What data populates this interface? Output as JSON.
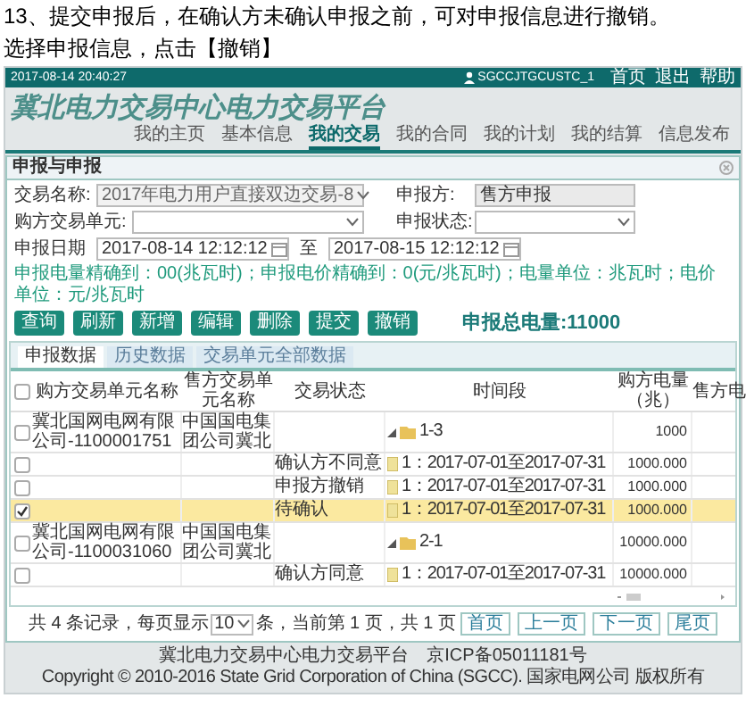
{
  "instructions": [
    "13、提交申报后，在确认方未确认申报之前，可对申报信息进行撤销。",
    "选择申报信息，点击【撤销】"
  ],
  "top_bar": {
    "datetime": "2017-08-14 20:40:27",
    "user": "SGCCJTGCUSTC_1",
    "links": [
      "首页",
      "退出",
      "帮助"
    ]
  },
  "site_title": "冀北电力交易中心电力交易平台",
  "nav": [
    {
      "label": "我的主页",
      "selected": false
    },
    {
      "label": "基本信息",
      "selected": false
    },
    {
      "label": "我的交易",
      "selected": true
    },
    {
      "label": "我的合同",
      "selected": false
    },
    {
      "label": "我的计划",
      "selected": false
    },
    {
      "label": "我的结算",
      "selected": false
    },
    {
      "label": "信息发布",
      "selected": false
    }
  ],
  "dialog": {
    "title": "申报与申报",
    "form": {
      "trade_label": "交易名称:",
      "trade_value": "2017年电力用户直接双边交易-8",
      "declarer_label": "申报方:",
      "declarer_value": "售方申报",
      "buyer_unit_label": "购方交易单元:",
      "status_label": "申报状态:",
      "date_label": "申报日期",
      "date_from": "2017-08-14 12:12:12",
      "date_sep": "至",
      "date_to": "2017-08-15 12:12:12"
    },
    "note": "申报电量精确到：00(兆瓦时)；申报电价精确到：0(元/兆瓦时)；电量单位：兆瓦时；电价单位：元/兆瓦时",
    "buttons": [
      "查询",
      "刷新",
      "新增",
      "编辑",
      "删除",
      "提交",
      "撤销"
    ],
    "total": "申报总电量:11000",
    "tabs": [
      {
        "label": "申报数据",
        "selected": true
      },
      {
        "label": "历史数据",
        "selected": false
      },
      {
        "label": "交易单元全部数据",
        "selected": false
      }
    ],
    "table": {
      "all_checked": false,
      "columns": [
        "购方交易单元名称",
        "售方交易单元名称",
        "交易状态",
        "时间段",
        "购方电量（兆）",
        "售方电"
      ],
      "rows": [
        {
          "kind": "group",
          "checked": false,
          "selected": false,
          "expanded": true,
          "buyer": "冀北国网电网有限公司-1100001751",
          "seller": "中国国电集团公司冀北",
          "status": "",
          "period": "1-3",
          "quantity": "1000"
        },
        {
          "kind": "item",
          "checked": false,
          "selected": false,
          "buyer": "",
          "seller": "",
          "status": "确认方不同意",
          "period": "1：2017-07-01至2017-07-31",
          "quantity": "1000.000"
        },
        {
          "kind": "item",
          "checked": false,
          "selected": false,
          "buyer": "",
          "seller": "",
          "status": "申报方撤销",
          "period": "1：2017-07-01至2017-07-31",
          "quantity": "1000.000"
        },
        {
          "kind": "item",
          "checked": true,
          "selected": true,
          "buyer": "",
          "seller": "",
          "status": "待确认",
          "period": "1：2017-07-01至2017-07-31",
          "quantity": "1000.000"
        },
        {
          "kind": "group",
          "checked": false,
          "selected": false,
          "expanded": true,
          "buyer": "冀北国网电网有限公司-1100031060",
          "seller": "中国国电集团公司冀北",
          "status": "",
          "period": "2-1",
          "quantity": "10000.000"
        },
        {
          "kind": "item",
          "checked": false,
          "selected": false,
          "buyer": "",
          "seller": "",
          "status": "确认方同意",
          "period": "1：2017-07-01至2017-07-31",
          "quantity": "10000.000"
        }
      ]
    },
    "pager": {
      "summary_before": "共 4 条记录，每页显示",
      "page_size": "10",
      "summary_after": "条，当前第 1 页，共 1 页",
      "buttons": [
        "首页",
        "上一页",
        "下一页",
        "尾页"
      ]
    }
  },
  "footer": [
    "冀北电力交易中心电力交易平台　京ICP备05011181号",
    "Copyright © 2010-2016 State Grid Corporation of China (SGCC). 国家电网公司 版权所有"
  ]
}
